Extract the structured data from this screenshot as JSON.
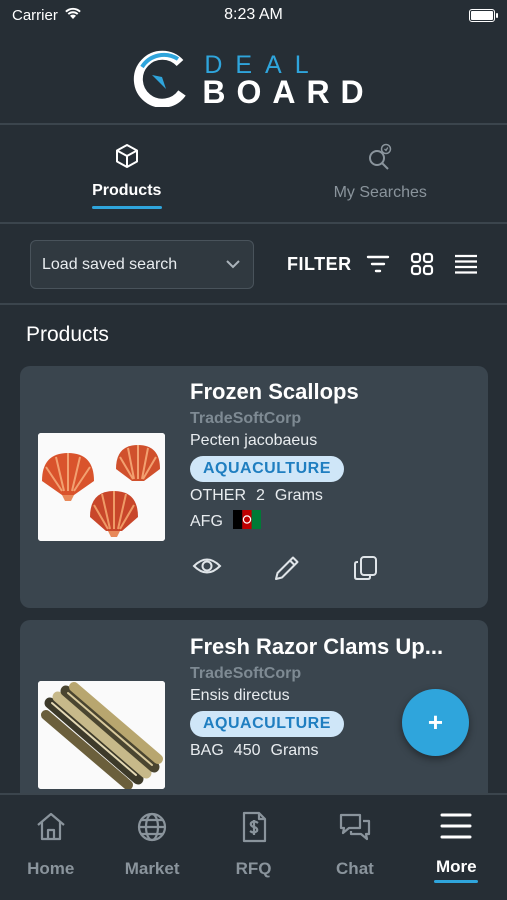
{
  "status_bar": {
    "carrier": "Carrier",
    "time": "8:23 AM"
  },
  "logo": {
    "line1": "DEAL",
    "line2": "BOARD",
    "icon": "dealboard-logo-icon"
  },
  "tabs": [
    {
      "label": "Products",
      "icon": "cube-icon",
      "active": true
    },
    {
      "label": "My Searches",
      "icon": "saved-search-icon",
      "active": false
    }
  ],
  "toolbar": {
    "select_label": "Load saved search",
    "filter_label": "FILTER",
    "icons": [
      "filter-lines-icon",
      "grid-view-icon",
      "list-view-icon"
    ]
  },
  "section_title": "Products",
  "products": [
    {
      "title": "Frozen Scallops",
      "company": "TradeSoftCorp",
      "latin_name": "Pecten jacobaeus",
      "badge": "AQUACULTURE",
      "package": "OTHER",
      "quantity": "2",
      "unit": "Grams",
      "country": "AFG",
      "flag": "afghanistan-flag-icon"
    },
    {
      "title": "Fresh Razor Clams Up...",
      "company": "TradeSoftCorp",
      "latin_name": "Ensis directus",
      "badge": "AQUACULTURE",
      "package": "BAG",
      "quantity": "450",
      "unit": "Grams"
    }
  ],
  "fab": {
    "label": "+"
  },
  "bottom_nav": [
    {
      "label": "Home",
      "icon": "home-icon",
      "active": false
    },
    {
      "label": "Market",
      "icon": "globe-icon",
      "active": false
    },
    {
      "label": "RFQ",
      "icon": "invoice-dollar-icon",
      "active": false
    },
    {
      "label": "Chat",
      "icon": "chat-bubbles-icon",
      "active": false
    },
    {
      "label": "More",
      "icon": "menu-icon",
      "active": true
    }
  ],
  "colors": {
    "background": "#262e35",
    "card": "#3a454e",
    "accent": "#2fa5dc",
    "badge_bg": "#cfe6f8",
    "muted": "#8a949c"
  }
}
